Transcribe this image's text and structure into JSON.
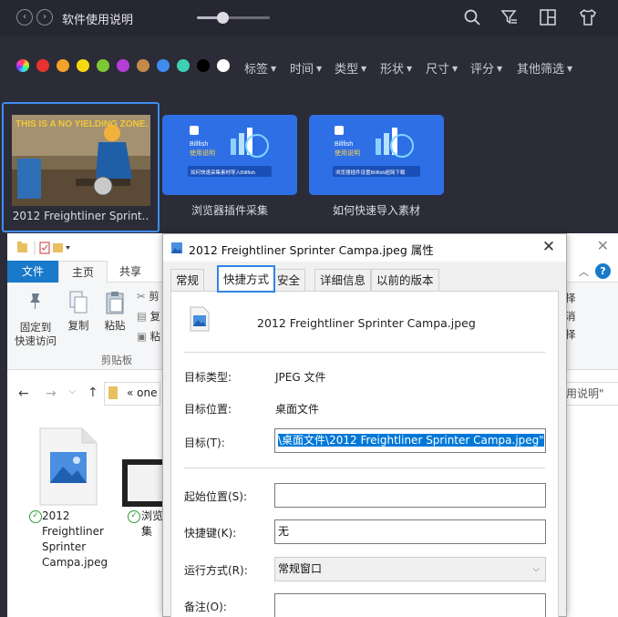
{
  "app": {
    "title": "软件使用说明",
    "nav_back": "‹",
    "nav_forward": "›",
    "zoom_level": 0.35,
    "colors": [
      "conic",
      "#e8322f",
      "#f3a22a",
      "#f6d80f",
      "#7cc833",
      "#b63ed4",
      "#c48a4a",
      "#3f8def",
      "#3ed0b4",
      "#000000",
      "#ffffff"
    ],
    "filters": [
      "标签",
      "时间",
      "类型",
      "形状",
      "尺寸",
      "评分",
      "其他筛选"
    ],
    "filter_caret": "▼",
    "icons": [
      "search-icon",
      "filter-icon",
      "layout-icon",
      "shirt-icon"
    ]
  },
  "gallery": {
    "items": [
      {
        "caption": "2012 Freightliner Sprint..",
        "poster_text": "THIS IS A NO YIELDING ZONE.",
        "selected": true
      },
      {
        "caption": "浏览器插件采集",
        "brand": "Billfish",
        "headline": "使用说明",
        "banner": "如何快速采集素材导入Billfish"
      },
      {
        "caption": "如何快速导入素材",
        "brand": "Billfish",
        "headline": "使用说明",
        "banner": "浏览器插件设置Billfish超简下载"
      }
    ]
  },
  "explorer": {
    "tabs": [
      "文件",
      "主页",
      "共享"
    ],
    "ribbon": {
      "pin_label": "固定到\n快速访问",
      "copy_label": "复制",
      "paste_label": "粘贴",
      "cut_label": "剪",
      "copy_path_label": "复",
      "shortcut_label": "粘",
      "group_label": "剪贴板",
      "right_labels": [
        "择",
        "消",
        "择"
      ]
    },
    "address": {
      "crumb": "«  one",
      "search_placeholder": "用说明\""
    },
    "files": [
      {
        "name": "2012\nFreightliner\nSprinter\nCampa.jpeg"
      },
      {
        "name": "浏览\n集"
      }
    ]
  },
  "dialog": {
    "title": "2012 Freightliner Sprinter Campa.jpeg 属性",
    "close": "✕",
    "tabs": [
      "常规",
      "快捷方式",
      "安全",
      "详细信息",
      "以前的版本"
    ],
    "active_tab": "快捷方式",
    "file_name": "2012 Freightliner Sprinter Campa.jpeg",
    "fields": {
      "target_type_label": "目标类型:",
      "target_type_value": "JPEG 文件",
      "target_location_label": "目标位置:",
      "target_location_value": "桌面文件",
      "target_label": "目标(T):",
      "target_value": "\\桌面文件\\2012 Freightliner Sprinter Campa.jpeg\"",
      "start_in_label": "起始位置(S):",
      "start_in_value": "",
      "shortcut_key_label": "快捷键(K):",
      "shortcut_key_value": "无",
      "run_label": "运行方式(R):",
      "run_value": "常规窗口",
      "comment_label": "备注(O):",
      "comment_value": ""
    }
  }
}
